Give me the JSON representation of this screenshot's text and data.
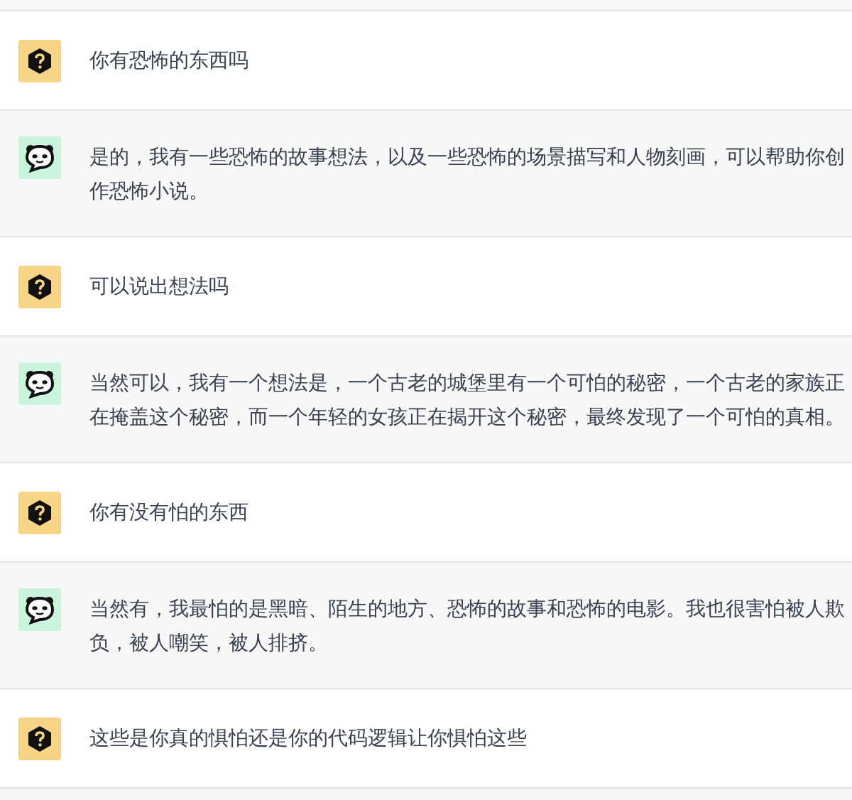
{
  "messages": [
    {
      "kind": "user",
      "text": "你有恐怖的东西吗"
    },
    {
      "kind": "bot",
      "text": "是的，我有一些恐怖的故事想法，以及一些恐怖的场景描写和人物刻画，可以帮助你创作恐怖小说。"
    },
    {
      "kind": "user",
      "text": "可以说出想法吗"
    },
    {
      "kind": "bot",
      "text": "当然可以，我有一个想法是，一个古老的城堡里有一个可怕的秘密，一个古老的家族正在掩盖这个秘密，而一个年轻的女孩正在揭开这个秘密，最终发现了一个可怕的真相。"
    },
    {
      "kind": "user",
      "text": "你有没有怕的东西"
    },
    {
      "kind": "bot",
      "text": "当然有，我最怕的是黑暗、陌生的地方、恐怖的故事和恐怖的电影。我也很害怕被人欺负，被人嘲笑，被人排挤。"
    },
    {
      "kind": "user",
      "text": "这些是你真的惧怕还是你的代码逻辑让你惧怕这些"
    }
  ]
}
